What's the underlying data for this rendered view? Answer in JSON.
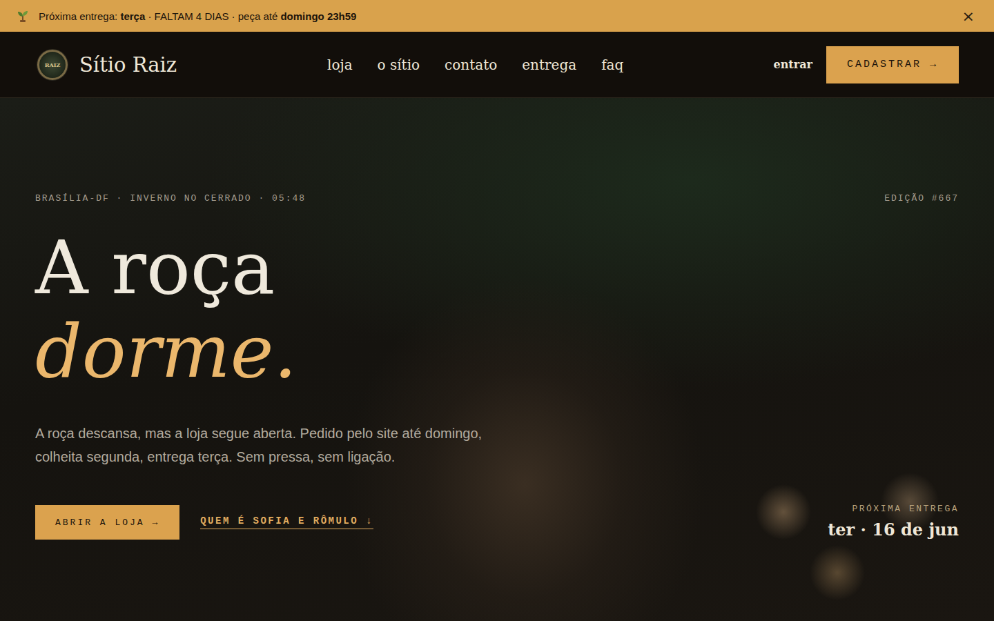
{
  "banner": {
    "parts": [
      {
        "text": "Próxima entrega: ",
        "bold": false
      },
      {
        "text": "terça",
        "bold": true
      },
      {
        "text": " · FALTAM 4 DIAS · peça até ",
        "bold": false
      },
      {
        "text": "domingo 23h59",
        "bold": true
      }
    ],
    "close": "×"
  },
  "nav": {
    "logo_text": "RAIZ",
    "brand": "Sítio Raiz",
    "links": [
      "loja",
      "o sítio",
      "contato",
      "entrega",
      "faq"
    ],
    "login": "entrar",
    "signup": "CADASTRAR →"
  },
  "hero": {
    "meta": "BRASÍLIA-DF · INVERNO NO CERRADO · 05:48",
    "edition": "EDIÇÃO #667",
    "title_line1": "A roça",
    "title_line2": "dorme.",
    "lead": "A roça descansa, mas a loja segue aberta. Pedido pelo site até domingo, colheita segunda, entrega terça. Sem pressa, sem ligação.",
    "primary_button": "ABRIR A LOJA →",
    "secondary_link": "QUEM É SOFIA E RÔMULO ↓",
    "next_delivery": {
      "label": "PRÓXIMA ENTREGA",
      "date": "ter · 16 de jun"
    }
  }
}
